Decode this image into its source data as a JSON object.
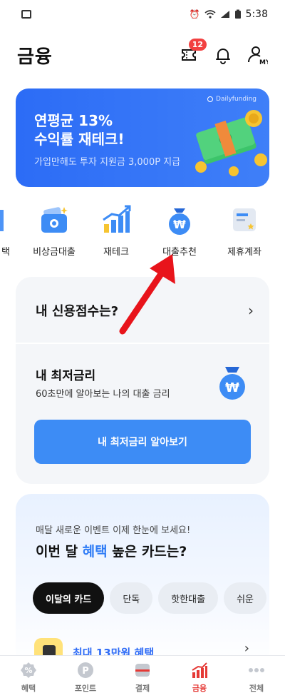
{
  "status": {
    "time": "5:38",
    "battery": "100%"
  },
  "header": {
    "title": "금융",
    "badge_count": "12"
  },
  "banner": {
    "brand": "Dailyfunding",
    "line1": "연평균 13%",
    "line2": "수익률 재테크!",
    "line3": "가입만해도 투자 지원금 3,000P 지급"
  },
  "quick_menu": [
    {
      "label": "택",
      "icon": "partial-icon"
    },
    {
      "label": "비상금대출",
      "icon": "wallet-icon"
    },
    {
      "label": "재테크",
      "icon": "growth-chart-icon"
    },
    {
      "label": "대출추천",
      "icon": "money-bag-icon"
    },
    {
      "label": "제휴계좌",
      "icon": "bank-book-icon"
    }
  ],
  "credit": {
    "title": "내 신용점수는?",
    "rate_title": "내 최저금리",
    "rate_sub": "60초만에 알아보는 나의 대출 금리",
    "cta": "내 최저금리 알아보기"
  },
  "cards": {
    "sub": "매달 새로운 이벤트 이제 한눈에 보세요!",
    "head_pre": "이번 달 ",
    "head_accent": "혜택",
    "head_post": " 높은 카드는?",
    "chips": [
      "이달의 카드",
      "단독",
      "핫한대출",
      "쉬운"
    ],
    "promo": "최대 13만원 혜택"
  },
  "bottom_nav": [
    {
      "label": "혜택",
      "icon": "percent-icon"
    },
    {
      "label": "포인트",
      "icon": "point-icon"
    },
    {
      "label": "결제",
      "icon": "card-scan-icon"
    },
    {
      "label": "금융",
      "icon": "finance-chart-icon"
    },
    {
      "label": "전체",
      "icon": "more-icon"
    }
  ],
  "colors": {
    "accent": "#2f7cf6",
    "banner": "#2c6cf6",
    "badge": "#f24141",
    "active_nav": "#e53935"
  }
}
